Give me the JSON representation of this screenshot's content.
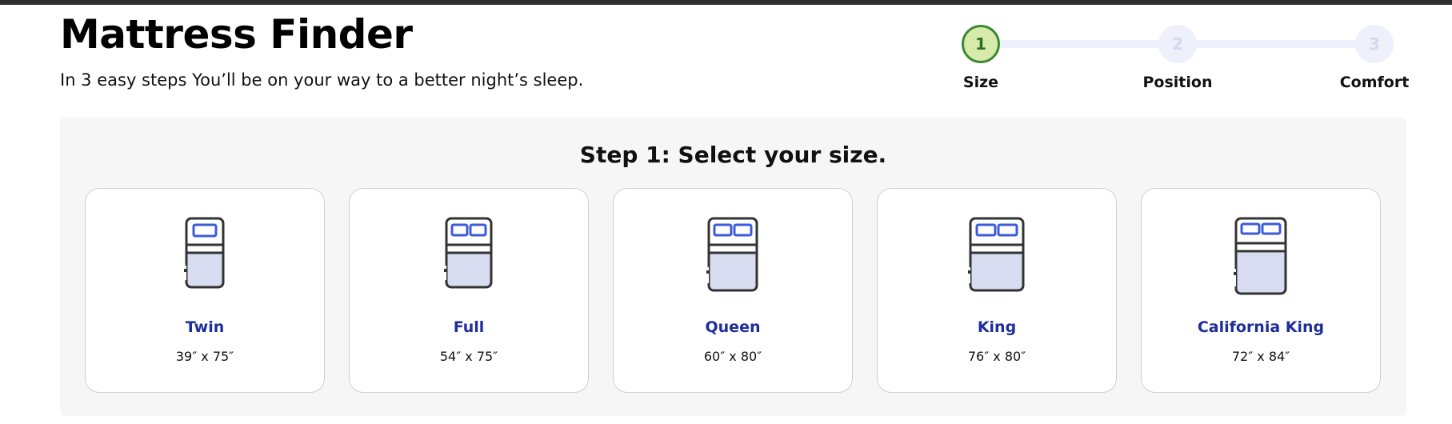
{
  "header": {
    "title": "Mattress Finder",
    "subtitle": "In 3 easy steps You’ll be on your way to a better night’s sleep."
  },
  "stepper": {
    "current_step": 1,
    "steps": [
      {
        "number": "1",
        "label": "Size"
      },
      {
        "number": "2",
        "label": "Position"
      },
      {
        "number": "3",
        "label": "Comfort"
      }
    ],
    "colors": {
      "active_fill": "#d6eba9",
      "active_border": "#3e8a34",
      "inactive": "#eef0fb"
    }
  },
  "panel": {
    "title": "Step 1: Select your size.",
    "sizes": [
      {
        "name": "Twin",
        "dims": "39″ x 75″",
        "icon": "twin-bed-icon"
      },
      {
        "name": "Full",
        "dims": "54″ x 75″",
        "icon": "full-bed-icon"
      },
      {
        "name": "Queen",
        "dims": "60″ x 80″",
        "icon": "queen-bed-icon"
      },
      {
        "name": "King",
        "dims": "76″ x 80″",
        "icon": "king-bed-icon"
      },
      {
        "name": "California King",
        "dims": "72″ x 84″",
        "icon": "california-king-bed-icon"
      }
    ]
  },
  "colors": {
    "accent": "#1e2e9a",
    "pillow": "#3b5bdb",
    "sheet": "#d8dcf0",
    "outline": "#333333"
  }
}
